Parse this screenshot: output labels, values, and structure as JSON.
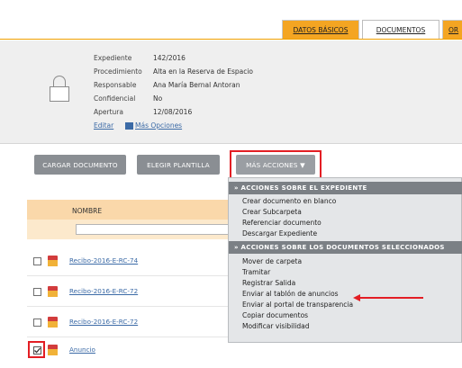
{
  "tabs": [
    {
      "label": "DATOS BÁSICOS"
    },
    {
      "label": "DOCUMENTOS"
    },
    {
      "label": "OR"
    }
  ],
  "record": {
    "fields": [
      {
        "label": "Expediente",
        "value": "142/2016"
      },
      {
        "label": "Procedimiento",
        "value": "Alta en la Reserva de Espacio"
      },
      {
        "label": "Responsable",
        "value": "Ana María Bernal Antoran"
      },
      {
        "label": "Confidencial",
        "value": "No"
      },
      {
        "label": "Apertura",
        "value": "12/08/2016"
      }
    ],
    "edit_link": "Editar",
    "more_options_link": "Más Opciones"
  },
  "toolbar": {
    "load_document": "CARGAR DOCUMENTO",
    "choose_template": "ELEGIR PLANTILLA",
    "more_actions": "MÁS ACCIONES ▼"
  },
  "table": {
    "column_name": "NOMBRE",
    "rows": [
      {
        "name": "Recibo-2016-E-RC-74",
        "checked": false
      },
      {
        "name": "Recibo-2016-E-RC-72",
        "checked": false
      },
      {
        "name": "Recibo-2016-E-RC-72",
        "checked": false
      },
      {
        "name": "Anuncio",
        "checked": true
      }
    ]
  },
  "dropdown": {
    "section_record": "» ACCIONES SOBRE EL EXPEDIENTE",
    "record_actions": [
      "Crear documento en blanco",
      "Crear Subcarpeta",
      "Referenciar documento",
      "Descargar Expediente"
    ],
    "section_selected": "» ACCIONES SOBRE LOS DOCUMENTOS SELECCIONADOS",
    "selected_actions": [
      "Mover de carpeta",
      "Tramitar",
      "Registrar Salida",
      "Enviar al tablón de anuncios",
      "Enviar al portal de transparencia",
      "Copiar documentos",
      "Modificar visibilidad"
    ]
  },
  "colors": {
    "accent_orange": "#f4a522",
    "highlight_red": "#e31e24",
    "button_gray": "#8a8e93",
    "menu_section": "#7b8085",
    "link_blue": "#3b6aa6"
  },
  "icons": [
    "lock-icon",
    "file-icon",
    "checkbox-icon",
    "arrow-left-icon",
    "options-icon"
  ]
}
